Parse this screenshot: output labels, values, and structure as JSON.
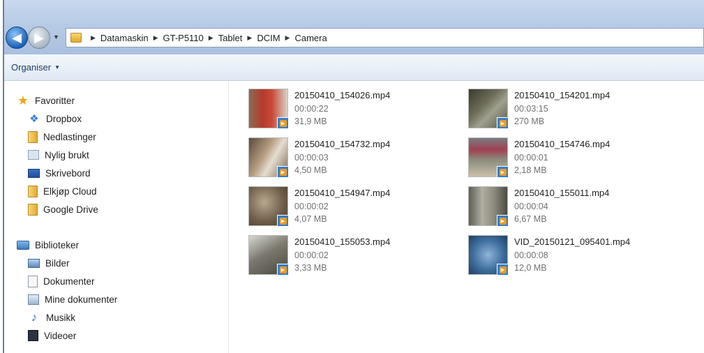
{
  "breadcrumb": [
    "Datamaskin",
    "GT-P5110",
    "Tablet",
    "DCIM",
    "Camera"
  ],
  "toolbar": {
    "organise_label": "Organiser"
  },
  "sidebar": {
    "favorites_header": "Favoritter",
    "favorites": [
      {
        "label": "Dropbox",
        "icon": "dropbox-icon"
      },
      {
        "label": "Nedlastinger",
        "icon": "folder-icon"
      },
      {
        "label": "Nylig brukt",
        "icon": "recent-places-icon"
      },
      {
        "label": "Skrivebord",
        "icon": "desktop-icon"
      },
      {
        "label": "Elkjøp Cloud",
        "icon": "folder-icon"
      },
      {
        "label": "Google Drive",
        "icon": "folder-icon"
      }
    ],
    "libraries_header": "Biblioteker",
    "libraries": [
      {
        "label": "Bilder",
        "icon": "pictures-icon"
      },
      {
        "label": "Dokumenter",
        "icon": "documents-icon"
      },
      {
        "label": "Mine dokumenter",
        "icon": "my-documents-icon"
      },
      {
        "label": "Musikk",
        "icon": "music-icon"
      },
      {
        "label": "Videoer",
        "icon": "videos-icon"
      }
    ]
  },
  "files": [
    {
      "name": "20150410_154026.mp4",
      "duration": "00:00:22",
      "size": "31,9 MB"
    },
    {
      "name": "20150410_154201.mp4",
      "duration": "00:03:15",
      "size": "270 MB"
    },
    {
      "name": "20150410_154732.mp4",
      "duration": "00:00:03",
      "size": "4,50 MB"
    },
    {
      "name": "20150410_154746.mp4",
      "duration": "00:00:01",
      "size": "2,18 MB"
    },
    {
      "name": "20150410_154947.mp4",
      "duration": "00:00:02",
      "size": "4,07 MB"
    },
    {
      "name": "20150410_155011.mp4",
      "duration": "00:00:04",
      "size": "6,67 MB"
    },
    {
      "name": "20150410_155053.mp4",
      "duration": "00:00:02",
      "size": "3,33 MB"
    },
    {
      "name": "VID_20150121_095401.mp4",
      "duration": "00:00:08",
      "size": "12,0 MB"
    }
  ],
  "colors": {
    "accent": "#2f7fd6",
    "play_badge": "#f39a1c",
    "secondary_text": "#707070"
  }
}
